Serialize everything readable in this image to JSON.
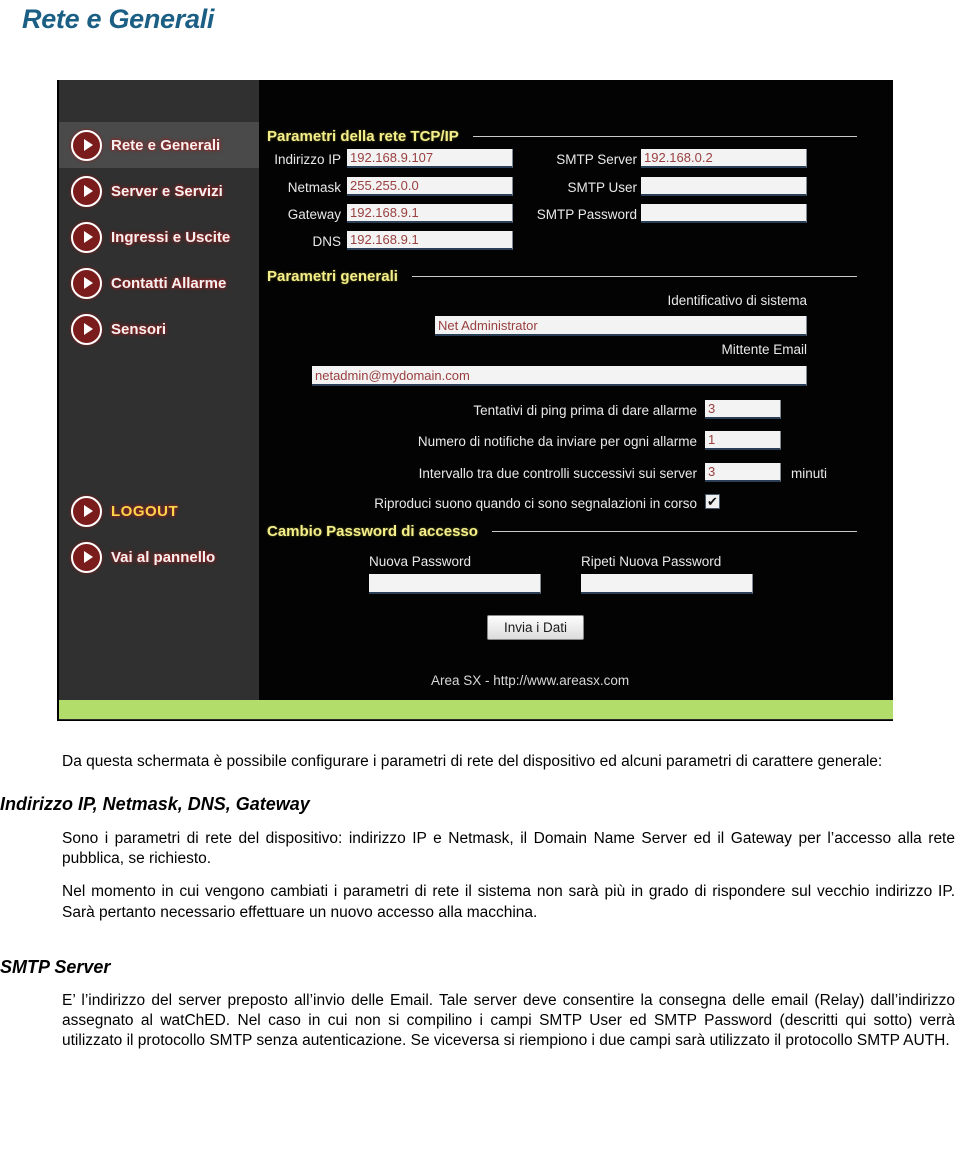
{
  "page_title": "Rete e Generali",
  "accent_color": "#1b5f85",
  "heading_color": "#f4ef8a",
  "green_bar_color": "#b3dd6a",
  "screenshot": {
    "sidebar": {
      "items": [
        {
          "label": "Rete e Generali",
          "selected": true
        },
        {
          "label": "Server e Servizi",
          "selected": false
        },
        {
          "label": "Ingressi e Uscite",
          "selected": false
        },
        {
          "label": "Contatti Allarme",
          "selected": false
        },
        {
          "label": "Sensori",
          "selected": false
        }
      ],
      "bottom_items": [
        {
          "label": "LOGOUT",
          "style": "logout"
        },
        {
          "label": "Vai al pannello",
          "style": "normal"
        }
      ]
    },
    "sections": {
      "tcpip": {
        "heading": "Parametri della rete TCP/IP",
        "fields": [
          {
            "label": "Indirizzo IP",
            "value": "192.168.9.107"
          },
          {
            "label": "Netmask",
            "value": "255.255.0.0"
          },
          {
            "label": "Gateway",
            "value": "192.168.9.1"
          },
          {
            "label": "DNS",
            "value": "192.168.9.1"
          }
        ],
        "smtp_fields": [
          {
            "label": "SMTP Server",
            "value": "192.168.0.2"
          },
          {
            "label": "SMTP User",
            "value": ""
          },
          {
            "label": "SMTP Password",
            "value": ""
          }
        ]
      },
      "generali": {
        "heading": "Parametri generali",
        "system_id_label": "Identificativo di sistema",
        "system_id_value": "Net Administrator",
        "sender_label": "Mittente Email",
        "sender_value": "netadmin@mydomain.com",
        "rows": [
          {
            "label": "Tentativi di ping prima di dare allarme",
            "value": "3",
            "suffix": ""
          },
          {
            "label": "Numero di notifiche da inviare per ogni allarme",
            "value": "1",
            "suffix": ""
          },
          {
            "label": "Intervallo tra due controlli successivi sui server",
            "value": "3",
            "suffix": "minuti"
          }
        ],
        "sound_label": "Riproduci suono quando ci sono segnalazioni in corso",
        "sound_checked": "✔"
      },
      "password": {
        "heading": "Cambio Password di accesso",
        "new_label": "Nuova Password",
        "new_value": "",
        "repeat_label": "Ripeti Nuova Password",
        "repeat_value": "",
        "submit_label": "Invia i Dati"
      }
    },
    "footer": "Area SX - http://www.areasx.com"
  },
  "document": {
    "intro": "Da questa schermata è possibile configurare i parametri di rete del dispositivo ed alcuni parametri di carattere generale:",
    "h_network": "Indirizzo IP, Netmask, DNS, Gateway",
    "p_network_1": "Sono i parametri di rete del dispositivo: indirizzo IP e Netmask, il Domain Name Server ed il Gateway per l’accesso alla rete pubblica, se richiesto.",
    "p_network_2": "Nel momento in cui vengono cambiati i parametri di rete il sistema non sarà più in grado di rispondere sul vecchio indirizzo IP. Sarà pertanto necessario effettuare un nuovo accesso alla macchina.",
    "h_smtp": "SMTP Server",
    "p_smtp": "E’ l’indirizzo del server preposto all’invio delle Email. Tale server deve consentire la consegna delle email (Relay) dall’indirizzo assegnato al watChED. Nel caso in cui non si compilino i campi SMTP User ed SMTP Password (descritti qui sotto) verrà utilizzato il protocollo SMTP senza autenticazione. Se viceversa si riempiono i due campi sarà utilizzato il protocollo SMTP AUTH."
  }
}
